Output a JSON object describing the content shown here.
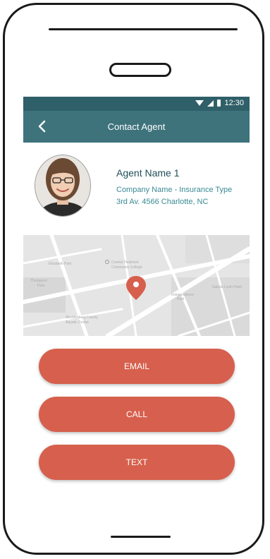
{
  "status_bar": {
    "time": "12:30"
  },
  "app_bar": {
    "title": "Contact Agent"
  },
  "agent": {
    "name": "Agent Name 1",
    "company": "Company Name - Insurance Type",
    "address": "3rd Av. 4566 Charlotte, NC"
  },
  "actions": {
    "email": "EMAIL",
    "call": "CALL",
    "text": "TEXT"
  },
  "colors": {
    "header": "#3e737c",
    "status": "#2f5f68",
    "accent": "#d6604d",
    "link": "#3a8a94"
  }
}
